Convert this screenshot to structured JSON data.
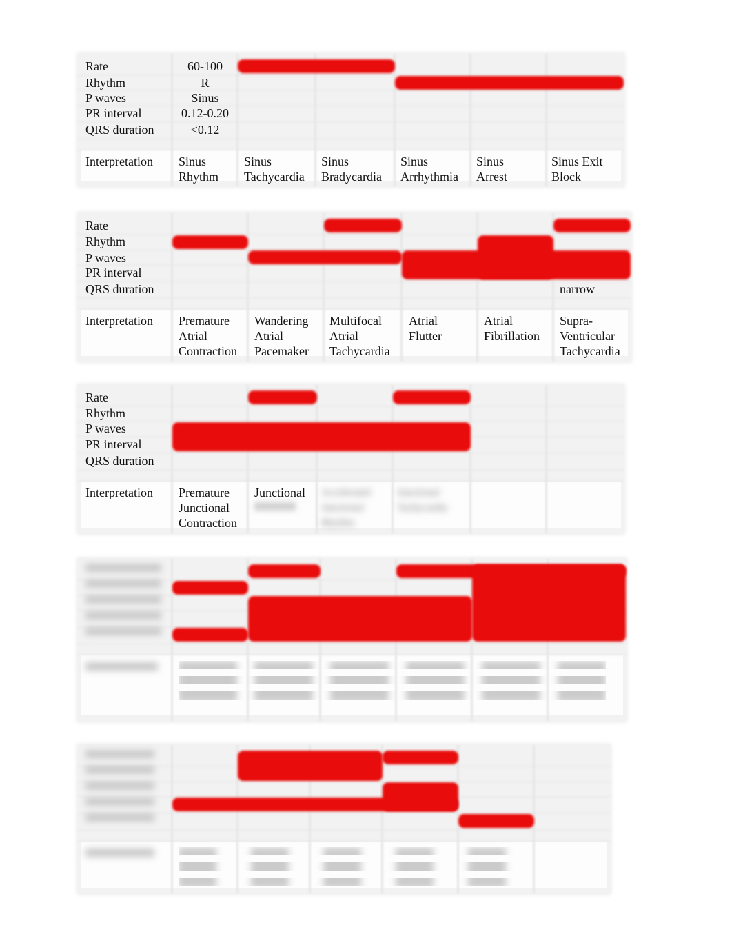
{
  "row_labels": [
    "Rate",
    "Rhythm",
    "P waves",
    "PR interval",
    "QRS duration",
    "Interpretation"
  ],
  "highlight_color": "#e80c0c",
  "sections": [
    {
      "legible": true,
      "values": {
        "rate": "60-100",
        "rhythm": "R",
        "p_waves": "Sinus",
        "pr_interval": "0.12-0.20",
        "qrs": "<0.12"
      },
      "interpretations": [
        "Sinus\nRhythm",
        "Sinus\nTachycardia",
        "Sinus\nBradycardia",
        "Sinus\nArrhythmia",
        "Sinus\nArrest",
        "Sinus Exit\nBlock"
      ],
      "highlights": [
        {
          "row_start": 0,
          "row_end": 0,
          "col_start": 1,
          "col_end": 2
        },
        {
          "row_start": 1,
          "row_end": 1,
          "col_start": 3,
          "col_end": 5
        }
      ]
    },
    {
      "legible": true,
      "qrs_note": {
        "column": 5,
        "text": "narrow"
      },
      "interpretations": [
        "Premature\nAtrial\nContraction",
        "Wandering\nAtrial\nPacemaker",
        "Multifocal\nAtrial\nTachycardia",
        "Atrial\nFlutter",
        "Atrial\nFibrillation",
        "Supra-\nVentricular\nTachycardia"
      ],
      "highlights": [
        {
          "row_start": 0,
          "row_end": 0,
          "col_start": 2,
          "col_end": 2
        },
        {
          "row_start": 0,
          "row_end": 0,
          "col_start": 5,
          "col_end": 5
        },
        {
          "row_start": 1,
          "row_end": 1,
          "col_start": 0,
          "col_end": 0
        },
        {
          "row_start": 2,
          "row_end": 2,
          "col_start": 1,
          "col_end": 2
        },
        {
          "row_start": 2,
          "row_end": 3,
          "col_start": 3,
          "col_end": 5
        },
        {
          "row_start": 1,
          "row_end": 3,
          "col_start": 4,
          "col_end": 4
        }
      ]
    },
    {
      "legible": true,
      "interpretations": [
        "Premature\nJunctional\nContraction",
        "Junctional\n",
        "",
        "",
        "",
        ""
      ],
      "blurred_interpretations": [
        "Accelerated\nJunctional\nRhythm",
        "Junctional\nTachycardia"
      ],
      "highlights": [
        {
          "row_start": 0,
          "row_end": 0,
          "col_start": 1,
          "col_end": 1
        },
        {
          "row_start": 0,
          "row_end": 0,
          "col_start": 3,
          "col_end": 3
        },
        {
          "row_start": 2,
          "row_end": 3,
          "col_start": 0,
          "col_end": 3
        }
      ]
    },
    {
      "legible": false,
      "highlights": [
        {
          "row_start": 0,
          "row_end": 0,
          "col_start": 1,
          "col_end": 1
        },
        {
          "row_start": 1,
          "row_end": 1,
          "col_start": 0,
          "col_end": 0
        },
        {
          "row_start": 4,
          "row_end": 4,
          "col_start": 0,
          "col_end": 0
        },
        {
          "row_start": 2,
          "row_end": 4,
          "col_start": 1,
          "col_end": 3
        },
        {
          "row_start": 0,
          "row_end": 0,
          "col_start": 3,
          "col_end": 5
        },
        {
          "row_start": 0,
          "row_end": 4,
          "col_start": 4,
          "col_end": 5
        }
      ]
    },
    {
      "legible": false,
      "highlights": [
        {
          "row_start": 0,
          "row_end": 1,
          "col_start": 1,
          "col_end": 2
        },
        {
          "row_start": 0,
          "row_end": 0,
          "col_start": 3,
          "col_end": 3
        },
        {
          "row_start": 2,
          "row_end": 3,
          "col_start": 3,
          "col_end": 3
        },
        {
          "row_start": 3,
          "row_end": 3,
          "col_start": 0,
          "col_end": 3
        },
        {
          "row_start": 4,
          "row_end": 4,
          "col_start": 4,
          "col_end": 4
        }
      ]
    }
  ]
}
